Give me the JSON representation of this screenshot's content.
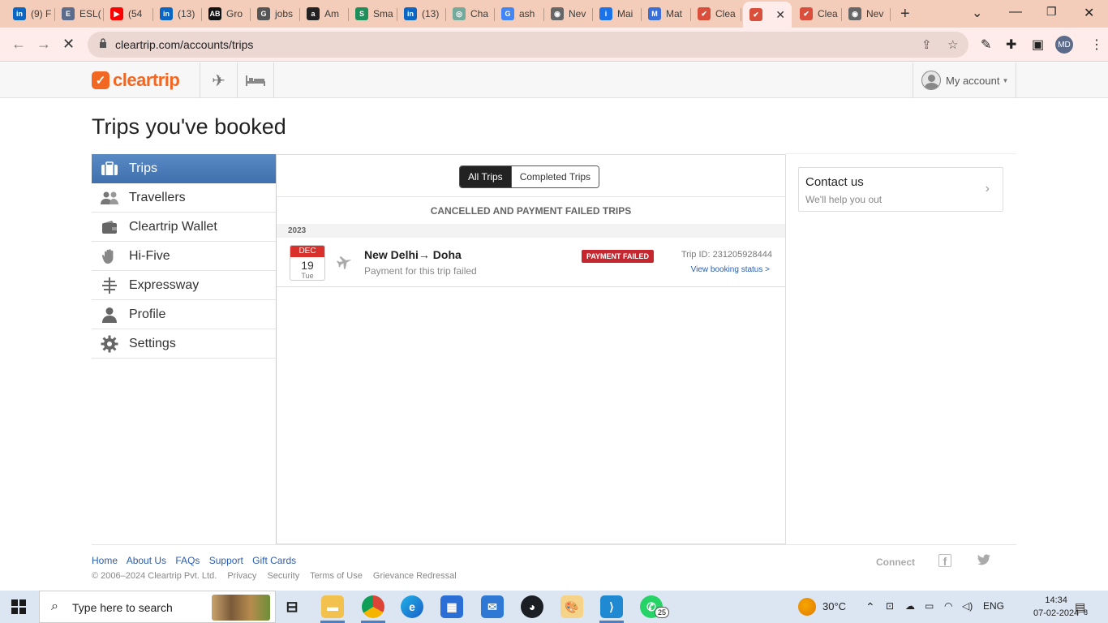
{
  "browser": {
    "tabs": [
      {
        "label": "(9) F",
        "icon": "linkedin-icon",
        "color": "#0a66c2",
        "glyph": "in"
      },
      {
        "label": "ESL(",
        "icon": "esl-icon",
        "color": "#5a6b8c",
        "glyph": "E"
      },
      {
        "label": "(54",
        "icon": "youtube-icon",
        "color": "#ff0000",
        "glyph": "▶"
      },
      {
        "label": "(13)",
        "icon": "linkedin-icon",
        "color": "#0a66c2",
        "glyph": "in"
      },
      {
        "label": "Gro",
        "icon": "ab-icon",
        "color": "#111111",
        "glyph": "AB"
      },
      {
        "label": "jobs",
        "icon": "ge-icon",
        "color": "#555555",
        "glyph": "G"
      },
      {
        "label": "Am",
        "icon": "amazon-icon",
        "color": "#222222",
        "glyph": "a"
      },
      {
        "label": "Sma",
        "icon": "s-icon",
        "color": "#1e8e5a",
        "glyph": "S"
      },
      {
        "label": "(13)",
        "icon": "linkedin-icon",
        "color": "#0a66c2",
        "glyph": "in"
      },
      {
        "label": "Cha",
        "icon": "chatgpt-icon",
        "color": "#74aa9c",
        "glyph": "◎"
      },
      {
        "label": "ash",
        "icon": "google-icon",
        "color": "#4285f4",
        "glyph": "G"
      },
      {
        "label": "Nev",
        "icon": "chrome-icon",
        "color": "#666666",
        "glyph": "◉"
      },
      {
        "label": "Mai",
        "icon": "info-icon",
        "color": "#1a73e8",
        "glyph": "i"
      },
      {
        "label": "Mat",
        "icon": "m-icon",
        "color": "#3b6fd8",
        "glyph": "M"
      },
      {
        "label": "Clea",
        "icon": "cleartrip-icon",
        "color": "#d94f3c",
        "glyph": "✔"
      },
      {
        "label": "",
        "icon": "cleartrip-icon",
        "color": "#d94f3c",
        "glyph": "✔",
        "active": true
      },
      {
        "label": "Clea",
        "icon": "cleartrip-icon",
        "color": "#d94f3c",
        "glyph": "✔"
      },
      {
        "label": "Nev",
        "icon": "chrome-icon",
        "color": "#666666",
        "glyph": "◉"
      }
    ],
    "url": "cleartrip.com/accounts/trips",
    "profile_initials": "MD"
  },
  "site": {
    "logo_text": "cleartrip",
    "brand_color": "#f26722",
    "account_label": "My account"
  },
  "page": {
    "title": "Trips you've booked"
  },
  "sidebar": {
    "items": [
      {
        "label": "Trips",
        "icon": "suitcase-icon",
        "active": true
      },
      {
        "label": "Travellers",
        "icon": "people-icon"
      },
      {
        "label": "Cleartrip Wallet",
        "icon": "wallet-icon"
      },
      {
        "label": "Hi-Five",
        "icon": "hand-icon"
      },
      {
        "label": "Expressway",
        "icon": "expressway-icon"
      },
      {
        "label": "Profile",
        "icon": "person-icon"
      },
      {
        "label": "Settings",
        "icon": "gear-icon"
      }
    ]
  },
  "trips": {
    "toggle_all": "All Trips",
    "toggle_completed": "Completed Trips",
    "section_heading": "CANCELLED AND PAYMENT FAILED TRIPS",
    "year": "2023",
    "rows": [
      {
        "month": "DEC",
        "day": "19",
        "weekday": "Tue",
        "route": "New Delhi→ Doha",
        "subtitle": "Payment for this trip failed",
        "status": "PAYMENT FAILED",
        "status_color": "#c6262e",
        "trip_id": "Trip ID: 231205928444",
        "view_link": "View booking status >"
      }
    ]
  },
  "contact": {
    "title": "Contact us",
    "subtitle": "We'll help you out"
  },
  "footer": {
    "links": [
      "Home",
      "About Us",
      "FAQs",
      "Support",
      "Gift Cards"
    ],
    "copyright": "© 2006–2024 Cleartrip Pvt. Ltd.",
    "legal": [
      "Privacy",
      "Security",
      "Terms of Use",
      "Grievance Redressal"
    ],
    "connect": "Connect"
  },
  "taskbar": {
    "search_placeholder": "Type here to search",
    "weather": "30°C",
    "language": "ENG",
    "time": "14:34",
    "date": "07-02-2024",
    "whatsapp_badge": "25",
    "notification_count": "8"
  }
}
